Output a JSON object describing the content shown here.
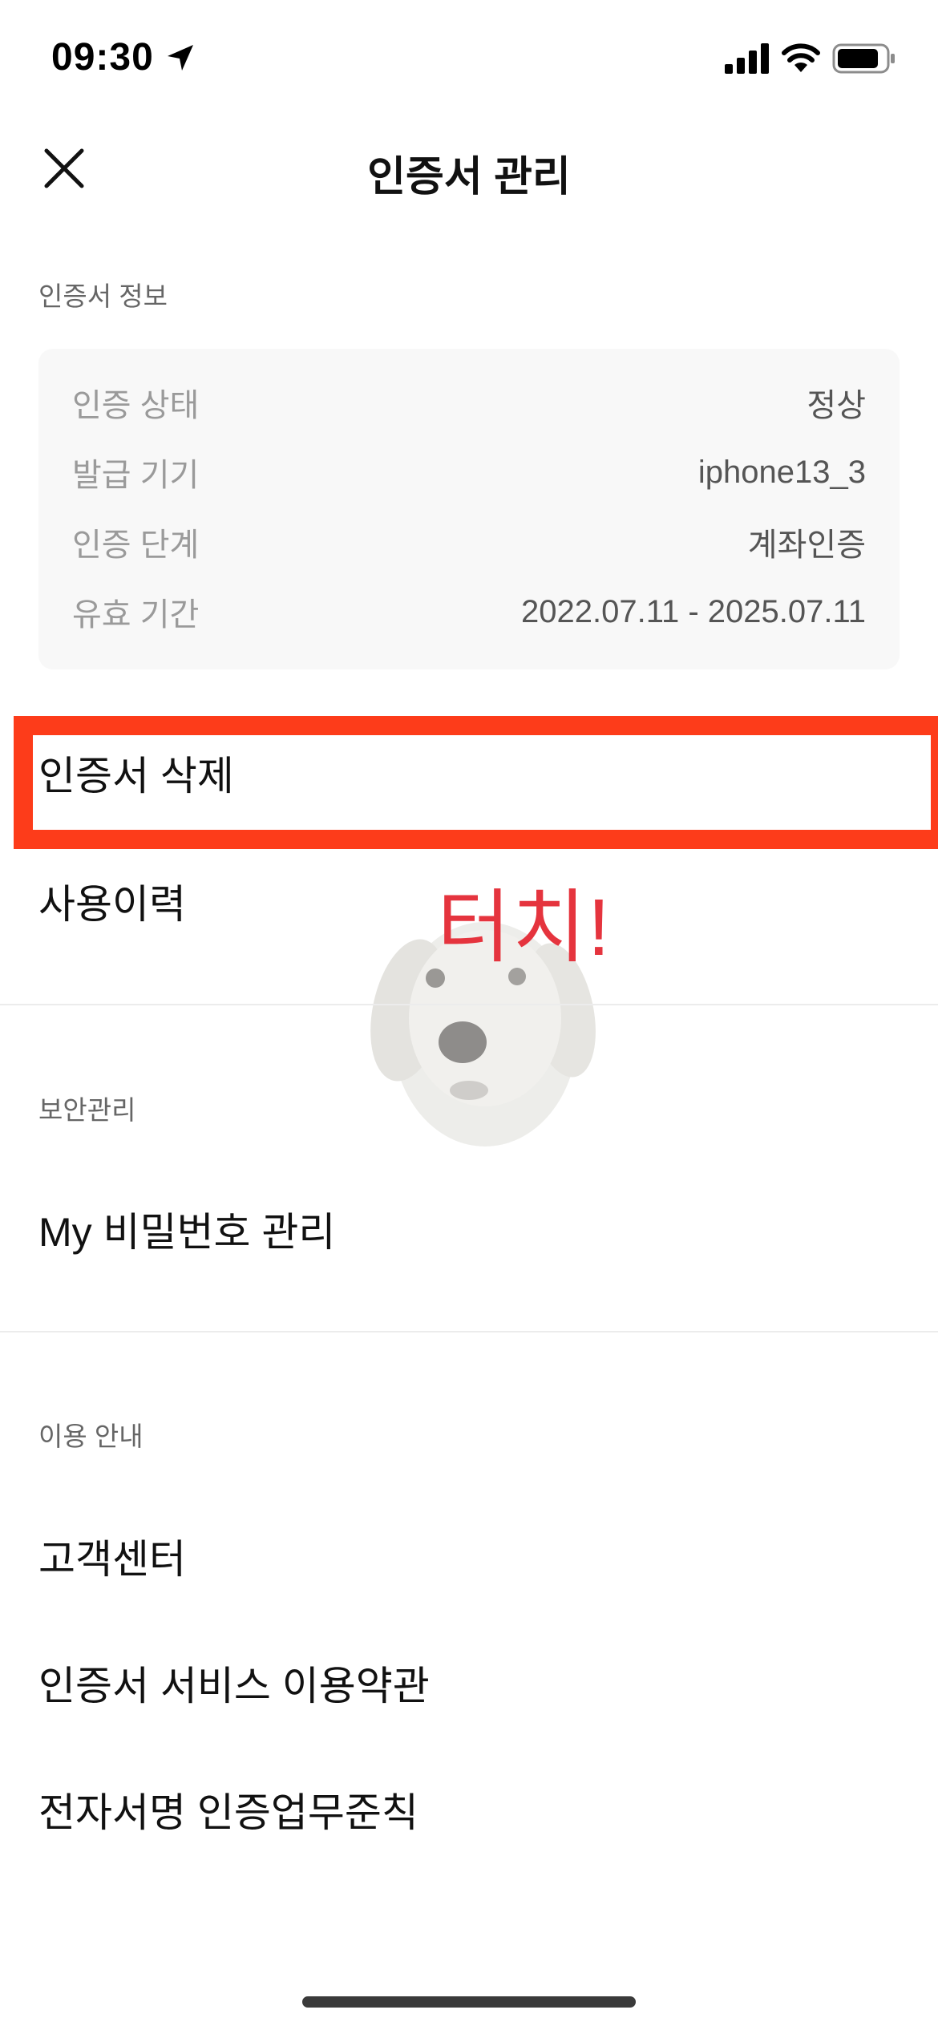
{
  "status_bar": {
    "time": "09:30",
    "icons": [
      "location-arrow-icon",
      "cellular-signal-icon",
      "wifi-icon",
      "battery-icon"
    ]
  },
  "nav": {
    "title": "인증서 관리",
    "close_icon": "close-icon"
  },
  "cert_info": {
    "section_label": "인증서 정보",
    "rows": [
      {
        "label": "인증 상태",
        "value": "정상"
      },
      {
        "label": "발급 기기",
        "value": "iphone13_3"
      },
      {
        "label": "인증 단계",
        "value": "계좌인증"
      },
      {
        "label": "유효 기간",
        "value": "2022.07.11 - 2025.07.11"
      }
    ]
  },
  "cert_actions": [
    {
      "label": "인증서 삭제"
    },
    {
      "label": "사용이력"
    }
  ],
  "security": {
    "section_label": "보안관리",
    "items": [
      {
        "label": "My 비밀번호 관리"
      }
    ]
  },
  "guide": {
    "section_label": "이용 안내",
    "items": [
      {
        "label": "고객센터"
      },
      {
        "label": "인증서 서비스 이용약관"
      },
      {
        "label": "전자서명 인증업무준칙"
      }
    ]
  },
  "overlay": {
    "annotation_text": "터치!",
    "highlight_color": "#fd3c1a",
    "annotation_color": "#e5343e"
  }
}
